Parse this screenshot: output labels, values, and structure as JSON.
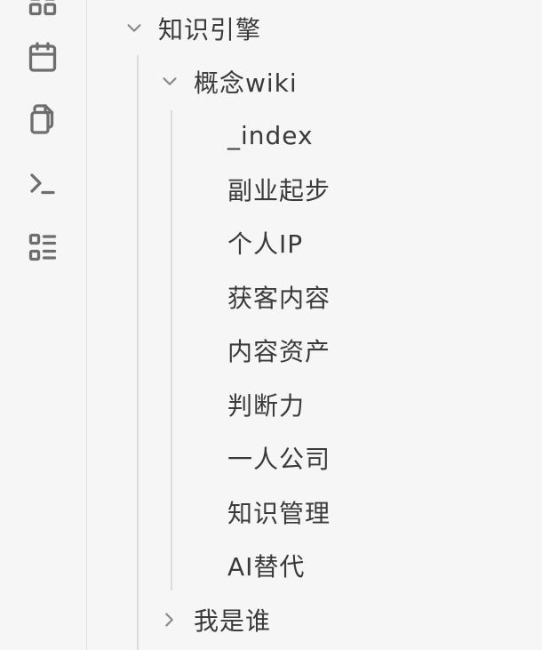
{
  "ribbon": {
    "icons": [
      "grid-icon",
      "calendar-icon",
      "copy-icon",
      "terminal-icon",
      "list-icon"
    ]
  },
  "tree": {
    "root": {
      "label": "知识引擎",
      "expanded": true,
      "children": {
        "concept_wiki": {
          "label": "概念wiki",
          "expanded": true,
          "items": [
            "_index",
            "副业起步",
            "个人IP",
            "获客内容",
            "内容资产",
            "判断力",
            "一人公司",
            "知识管理",
            "AI替代"
          ]
        },
        "who_am_i": {
          "label": "我是谁",
          "expanded": false
        }
      }
    }
  }
}
